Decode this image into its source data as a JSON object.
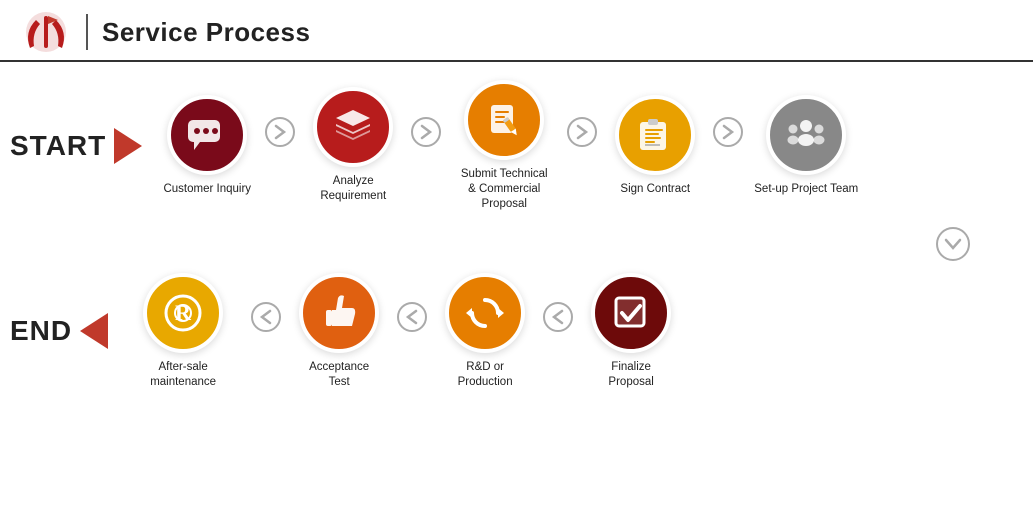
{
  "header": {
    "title": "Service Process"
  },
  "start_label": "START",
  "end_label": "END",
  "row1": {
    "steps": [
      {
        "id": "customer-inquiry",
        "label": "Customer Inquiry",
        "color": "dark-red"
      },
      {
        "id": "analyze-requirement",
        "label": "Analyze Requirement",
        "color": "red"
      },
      {
        "id": "submit-technical",
        "label": "Submit Technical\n& Commercial\nProposal",
        "color": "orange"
      },
      {
        "id": "sign-contract",
        "label": "Sign Contract",
        "color": "gold"
      },
      {
        "id": "setup-project-team",
        "label": "Set-up Project Team",
        "color": "gray"
      }
    ]
  },
  "row2": {
    "steps": [
      {
        "id": "aftersale-maintenance",
        "label": "After-sale maintenance",
        "color": "gold2"
      },
      {
        "id": "acceptance-test",
        "label": "Acceptance\nTest",
        "color": "orange2"
      },
      {
        "id": "rd-production",
        "label": "R&D or\nProduction",
        "color": "orange"
      },
      {
        "id": "finalize-proposal",
        "label": "Finalize\nProposal",
        "color": "dark-red2"
      }
    ]
  }
}
